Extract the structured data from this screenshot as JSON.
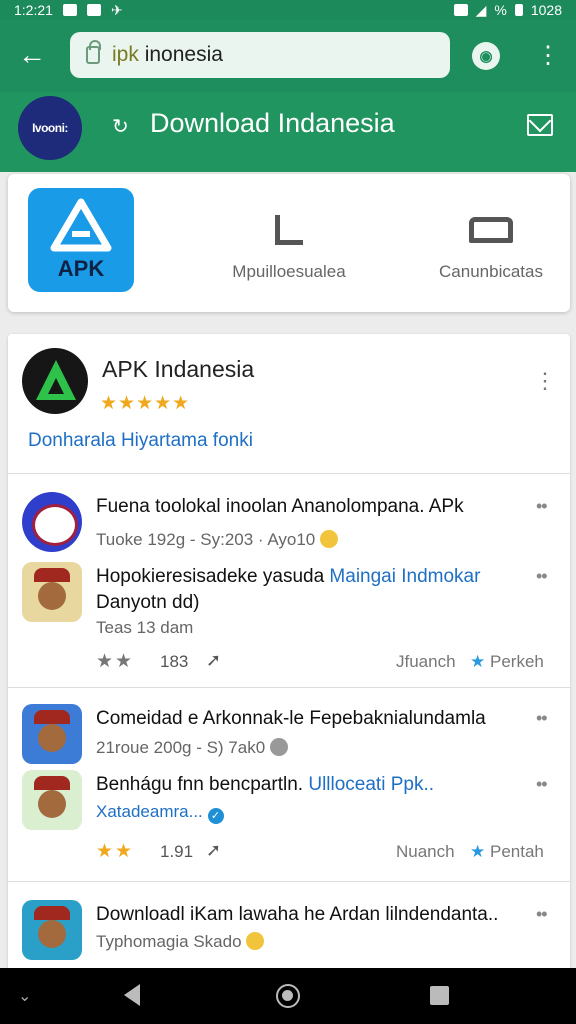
{
  "status_bar": {
    "time": "1:2:21",
    "battery_text": "1028",
    "signal_text": "%"
  },
  "browser": {
    "url_highlight": "ipk",
    "url_rest": "inonesia"
  },
  "header": {
    "logo_text": "Ivooni:",
    "title": "Download Indanesia"
  },
  "quick_links": {
    "apk_label": "APK",
    "item1_label": "Mpuilloesualea",
    "item2_label": "Canunbicatas"
  },
  "featured_app": {
    "name": "APK Indanesia",
    "stars": "★★★★★",
    "link_text": "Donharala Hiyartama fonki"
  },
  "posts": [
    {
      "title": "Fuena toolokal inoolan Ananolompana. APk",
      "subtitle": "Tuoke 192g - Sy:203 · Ayo10"
    },
    {
      "title_main": "Hopokieresisadeke yasuda",
      "title_blue": "Maingai  Indmokar",
      "title_line2": "Danyotn dd)",
      "subtitle": "Teas 13 dam",
      "stars": "★★",
      "count": "183",
      "meta_left": "Jfuanch",
      "meta_right": "Perkeh"
    },
    {
      "title": "Comeidad e Arkonnak-le Fepebaknialundamla",
      "subtitle": "21roue 200g - S) 7ak0"
    },
    {
      "title_main": "Benhágu fnn bencpartln.",
      "title_blue": "Ullloceati Ppk..",
      "subtitle_blue": "Xatadeamra...",
      "stars": "★★",
      "count": "1.91",
      "meta_left": "Nuanch",
      "meta_right": "Pentah"
    },
    {
      "title": "Downloadl iKam lawaha he Ardan lilndendanta..",
      "subtitle": "Typhomagia Skado"
    }
  ],
  "icons": {
    "back": "arrow-left",
    "tab": "tab-switcher",
    "menu": "vertical-dots",
    "mail": "mail",
    "share": "share-arrow"
  },
  "colors": {
    "brand_green": "#21955f",
    "link_blue": "#1f6fc4",
    "star_orange": "#f0a81e"
  }
}
